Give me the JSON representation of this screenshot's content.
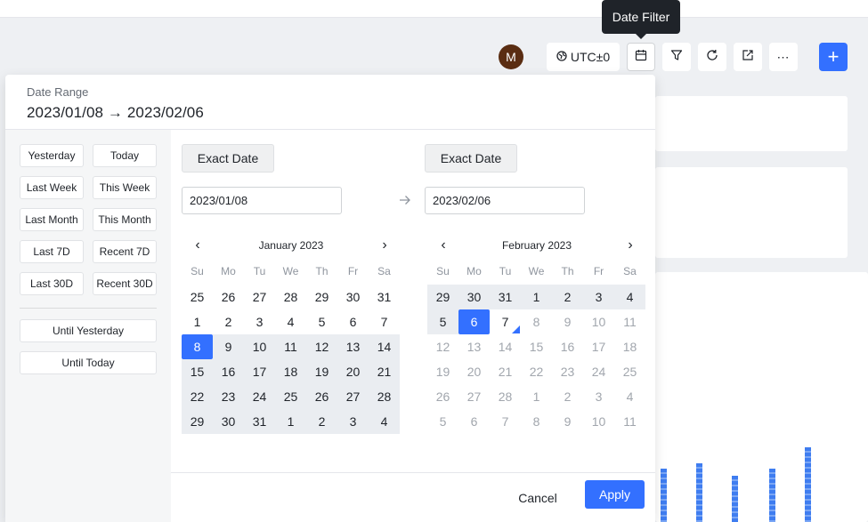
{
  "toolbar": {
    "avatar_initial": "M",
    "timezone_label": "UTC±0",
    "tooltip": "Date Filter",
    "icons": [
      "globe-icon",
      "calendar-icon",
      "filter-icon",
      "refresh-icon",
      "share-icon",
      "more-icon",
      "plus-icon"
    ]
  },
  "date_filter": {
    "label": "Date Range",
    "range": "2023/01/08 → 2023/02/06",
    "quick_options": {
      "yesterday": "Yesterday",
      "today": "Today",
      "last_week": "Last Week",
      "this_week": "This Week",
      "last_month": "Last Month",
      "this_month": "This Month",
      "last_7d": "Last 7D",
      "recent_7d": "Recent 7D",
      "last_30d": "Last 30D",
      "recent_30d": "Recent 30D",
      "until_yesterday": "Until Yesterday",
      "until_today": "Until Today"
    },
    "start": {
      "mode": "Exact Date",
      "value": "2023/01/08"
    },
    "end": {
      "mode": "Exact Date",
      "value": "2023/02/06"
    },
    "weekdays": [
      "Su",
      "Mo",
      "Tu",
      "We",
      "Th",
      "Fr",
      "Sa"
    ],
    "left_calendar": {
      "title": "January 2023",
      "prev": "‹",
      "next": "›",
      "weeks": [
        [
          "25",
          "26",
          "27",
          "28",
          "29",
          "30",
          "31"
        ],
        [
          "1",
          "2",
          "3",
          "4",
          "5",
          "6",
          "7"
        ],
        [
          "8",
          "9",
          "10",
          "11",
          "12",
          "13",
          "14"
        ],
        [
          "15",
          "16",
          "17",
          "18",
          "19",
          "20",
          "21"
        ],
        [
          "22",
          "23",
          "24",
          "25",
          "26",
          "27",
          "28"
        ],
        [
          "29",
          "30",
          "31",
          "1",
          "2",
          "3",
          "4"
        ]
      ]
    },
    "right_calendar": {
      "title": "February 2023",
      "prev": "‹",
      "next": "›",
      "weeks": [
        [
          "29",
          "30",
          "31",
          "1",
          "2",
          "3",
          "4"
        ],
        [
          "5",
          "6",
          "7",
          "8",
          "9",
          "10",
          "11"
        ],
        [
          "12",
          "13",
          "14",
          "15",
          "16",
          "17",
          "18"
        ],
        [
          "19",
          "20",
          "21",
          "22",
          "23",
          "24",
          "25"
        ],
        [
          "26",
          "27",
          "28",
          "1",
          "2",
          "3",
          "4"
        ],
        [
          "5",
          "6",
          "7",
          "8",
          "9",
          "10",
          "11"
        ]
      ]
    },
    "cancel_label": "Cancel",
    "apply_label": "Apply"
  },
  "colors": {
    "accent": "#3370ff",
    "range_bg": "#eaedf1"
  }
}
